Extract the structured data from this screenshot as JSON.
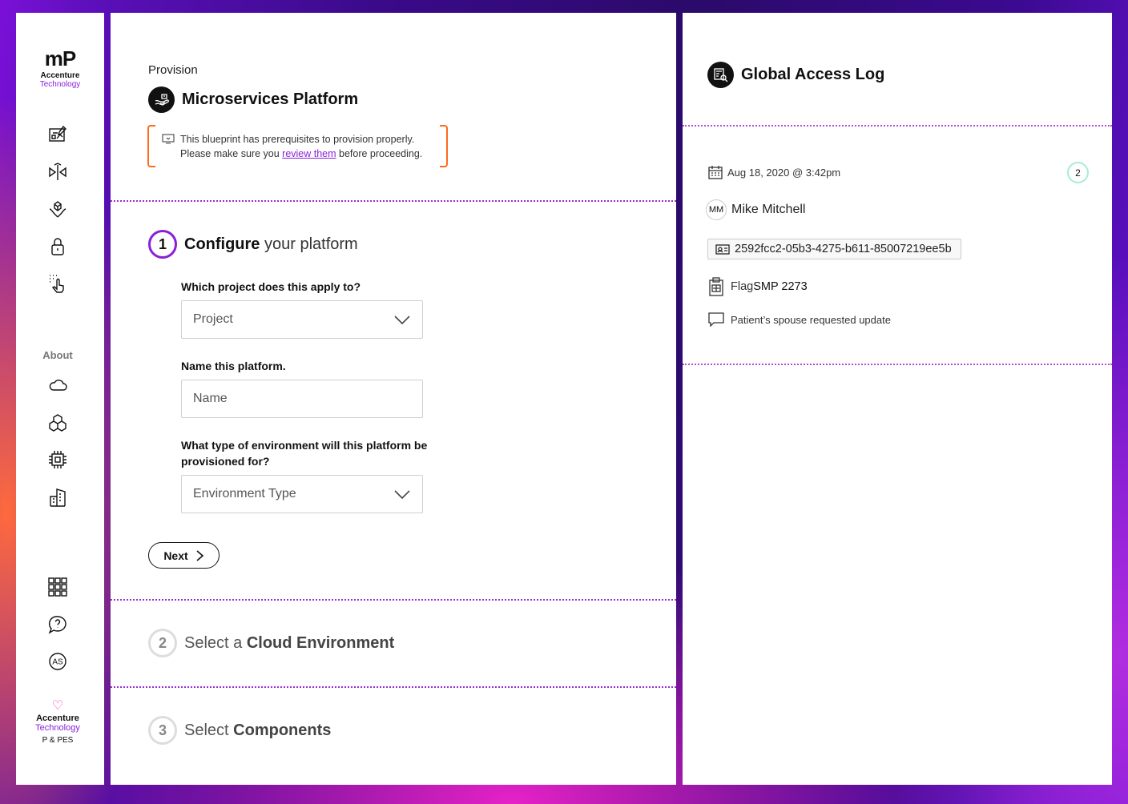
{
  "sidebar": {
    "logo_mark": "mP",
    "logo_line1": "Accenture",
    "logo_line2": "Technology",
    "about_label": "About",
    "footer_line1": "Accenture",
    "footer_line2": "Technology",
    "footer_line3": "P & PES",
    "profile_initials": "AS",
    "colors": {
      "accent": "#8a1fd8",
      "heart": "#e63cc6"
    }
  },
  "main": {
    "breadcrumb": "Provision",
    "title": "Microservices Platform",
    "notice": {
      "line1": "This blueprint has prerequisites to provision properly.",
      "line2_before": "Please make sure you ",
      "link": "review them",
      "line2_after": " before proceeding."
    },
    "steps": [
      {
        "number": "1",
        "prefix": "Configure",
        "suffix": " your platform"
      },
      {
        "number": "2",
        "prefix": "Select a ",
        "suffix": "Cloud Environment"
      },
      {
        "number": "3",
        "prefix": "Select ",
        "suffix": "Components"
      }
    ],
    "form": {
      "project_question": "Which project does this apply to?",
      "project_placeholder": "Project",
      "name_question": "Name this platform.",
      "name_placeholder": "Name",
      "env_question": "What type of environment will this platform be provisioned for?",
      "env_placeholder": "Environment Type",
      "next_label": "Next"
    }
  },
  "log": {
    "title": "Global Access Log",
    "timestamp": "Aug 18, 2020 @ 3:42pm",
    "count": "2",
    "user_initials": "MM",
    "user_name": "Mike Mitchell",
    "record_id": "2592fcc2-05b3-4275-b611-85007219ee5b",
    "flag_prefix": "Flag ",
    "flag_value": "SMP 2273",
    "comment": "Patient’s spouse requested update"
  }
}
